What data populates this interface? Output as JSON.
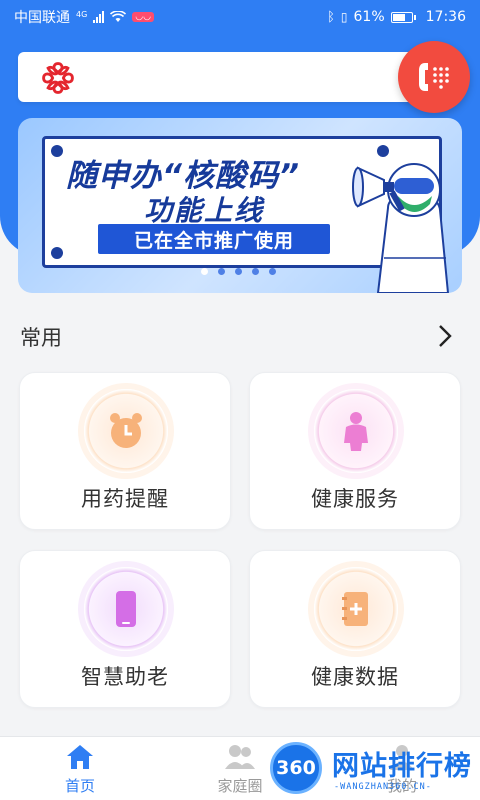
{
  "status_bar": {
    "carrier": "中国联通",
    "network": "4G",
    "battery": "61%",
    "time": "17:36"
  },
  "banner": {
    "headline": "随申办“核酸码”",
    "subline": "功能上线",
    "tag": "已在全市推广使用",
    "page_count": 5,
    "active_page": 1
  },
  "common": {
    "title": "常用",
    "items": [
      {
        "label": "用药提醒",
        "icon": "alarm-clock-icon",
        "color": "#f5a461"
      },
      {
        "label": "健康服务",
        "icon": "elderly-person-icon",
        "color": "#e46cc7"
      },
      {
        "label": "智慧助老",
        "icon": "phone-icon",
        "color": "#c45ad8"
      },
      {
        "label": "健康数据",
        "icon": "notebook-icon",
        "color": "#f5a461"
      }
    ]
  },
  "bottom_nav": {
    "items": [
      {
        "label": "首页",
        "icon": "home-icon",
        "active": true
      },
      {
        "label": "家庭圈",
        "icon": "family-icon",
        "active": false
      },
      {
        "label": "我的",
        "icon": "profile-icon",
        "active": false
      }
    ]
  },
  "watermark": {
    "badge": "360",
    "text": "网站排行榜",
    "subtext": "-WANGZHAN360.CN-"
  },
  "colors": {
    "header_blue": "#2f7ef3",
    "call_button": "#f24b3f",
    "active_nav": "#2f7ef3"
  }
}
